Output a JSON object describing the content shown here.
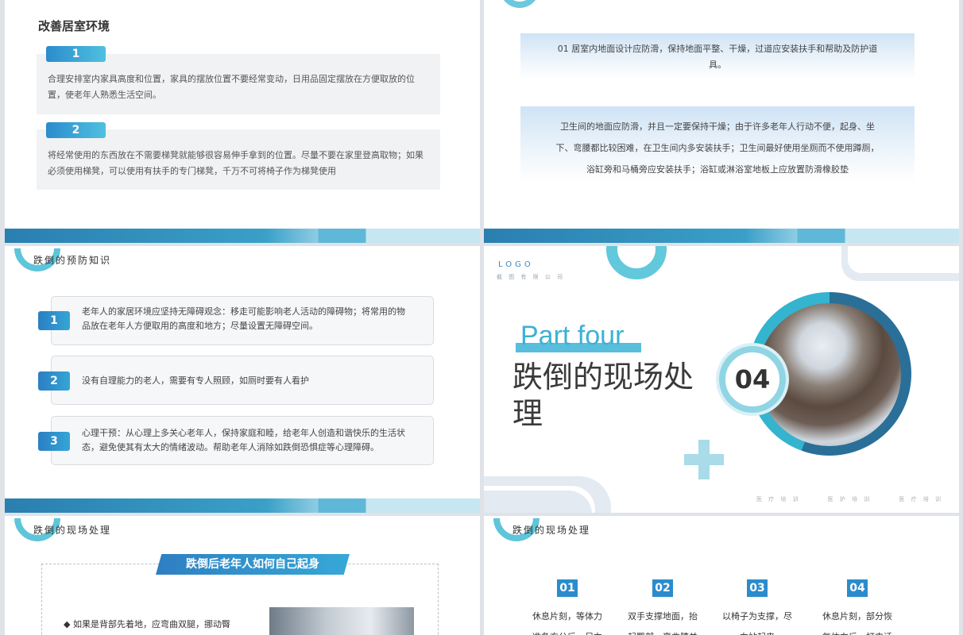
{
  "slide1": {
    "title": "改善居室环境",
    "items": [
      {
        "num": "1",
        "text": "合理安排室内家具高度和位置，家具的摆放位置不要经常变动，日用品固定摆放在方便取放的位置，使老年人熟悉生活空间。"
      },
      {
        "num": "2",
        "text": "将经常使用的东西放在不需要梯凳就能够很容易伸手拿到的位置。尽量不要在家里登高取物；如果必须使用梯凳，可以使用有扶手的专门梯凳，千万不可将椅子作为梯凳使用"
      }
    ]
  },
  "slide2": {
    "box1": "01 居室内地面设计应防滑，保持地面平整、干燥，过道应安装扶手和帮助及防护道具。",
    "box2": "卫生间的地面应防滑，并且一定要保持干燥；由于许多老年人行动不便，起身、坐下、弯腰都比较困难，在卫生间内多安装扶手；卫生间最好使用坐厕而不使用蹲厕，浴缸旁和马桶旁应安装扶手；浴缸或淋浴室地板上应放置防滑橡胶垫"
  },
  "slide3": {
    "section": "跌倒的预防知识",
    "items": [
      {
        "num": "1",
        "text": "老年人的家居环境应坚持无障碍观念：移走可能影响老人活动的障碍物；将常用的物品放在老年人方便取用的高度和地方；尽量设置无障碍空间。"
      },
      {
        "num": "2",
        "text": "没有自理能力的老人，需要有专人照顾，如厕时要有人看护"
      },
      {
        "num": "3",
        "text": "心理干预：从心理上多关心老年人，保持家庭和睦，给老年人创造和谐快乐的生活状态，避免使其有太大的情绪波动。帮助老年人消除如跌倒恐惧症等心理障碍。"
      }
    ]
  },
  "slide4": {
    "logo": "LOGO",
    "logo_sub": "截 图 有 限 公 司",
    "part": "Part four",
    "heading": "跌倒的现场处理",
    "number": "04",
    "tags": [
      "医 疗 培 训",
      "医 护 培 训",
      "医 疗 培 训"
    ]
  },
  "slide5": {
    "section": "跌倒的现场处理",
    "banner": "跌倒后老年人如何自己起身",
    "bullet": "◆  如果是背部先着地，应弯曲双腿，挪动臀"
  },
  "slide6": {
    "section": "跌倒的现场处理",
    "steps": [
      {
        "num": "01",
        "l1": "休息片刻，等体力",
        "l2": "准备充分后，尽力"
      },
      {
        "num": "02",
        "l1": "双手支撑地面，抬",
        "l2": "起臀部，弯曲膝关"
      },
      {
        "num": "03",
        "l1": "以椅子为支撑，尽",
        "l2": "力站起来"
      },
      {
        "num": "04",
        "l1": "休息片刻，部分恢",
        "l2": "复体力后，打电话"
      }
    ]
  }
}
